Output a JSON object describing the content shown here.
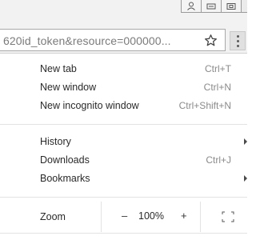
{
  "window": {
    "controls": [
      {
        "icon": "user-icon"
      },
      {
        "icon": "minimize-icon"
      },
      {
        "icon": "restore-icon"
      },
      {
        "icon": "close-icon"
      }
    ]
  },
  "omnibox": {
    "url": "620id_token&resource=000000...",
    "bookmark_icon": "star-icon",
    "menu_icon": "kebab-menu-icon"
  },
  "menu": {
    "group1": [
      {
        "label": "New tab",
        "shortcut": "Ctrl+T"
      },
      {
        "label": "New window",
        "shortcut": "Ctrl+N"
      },
      {
        "label": "New incognito window",
        "shortcut": "Ctrl+Shift+N"
      }
    ],
    "group2": [
      {
        "label": "History",
        "shortcut": "",
        "submenu": true
      },
      {
        "label": "Downloads",
        "shortcut": "Ctrl+J",
        "submenu": false
      },
      {
        "label": "Bookmarks",
        "shortcut": "",
        "submenu": true
      }
    ],
    "zoom": {
      "label": "Zoom",
      "minus": "–",
      "value": "100%",
      "plus": "+",
      "fullscreen_icon": "fullscreen-icon"
    }
  }
}
